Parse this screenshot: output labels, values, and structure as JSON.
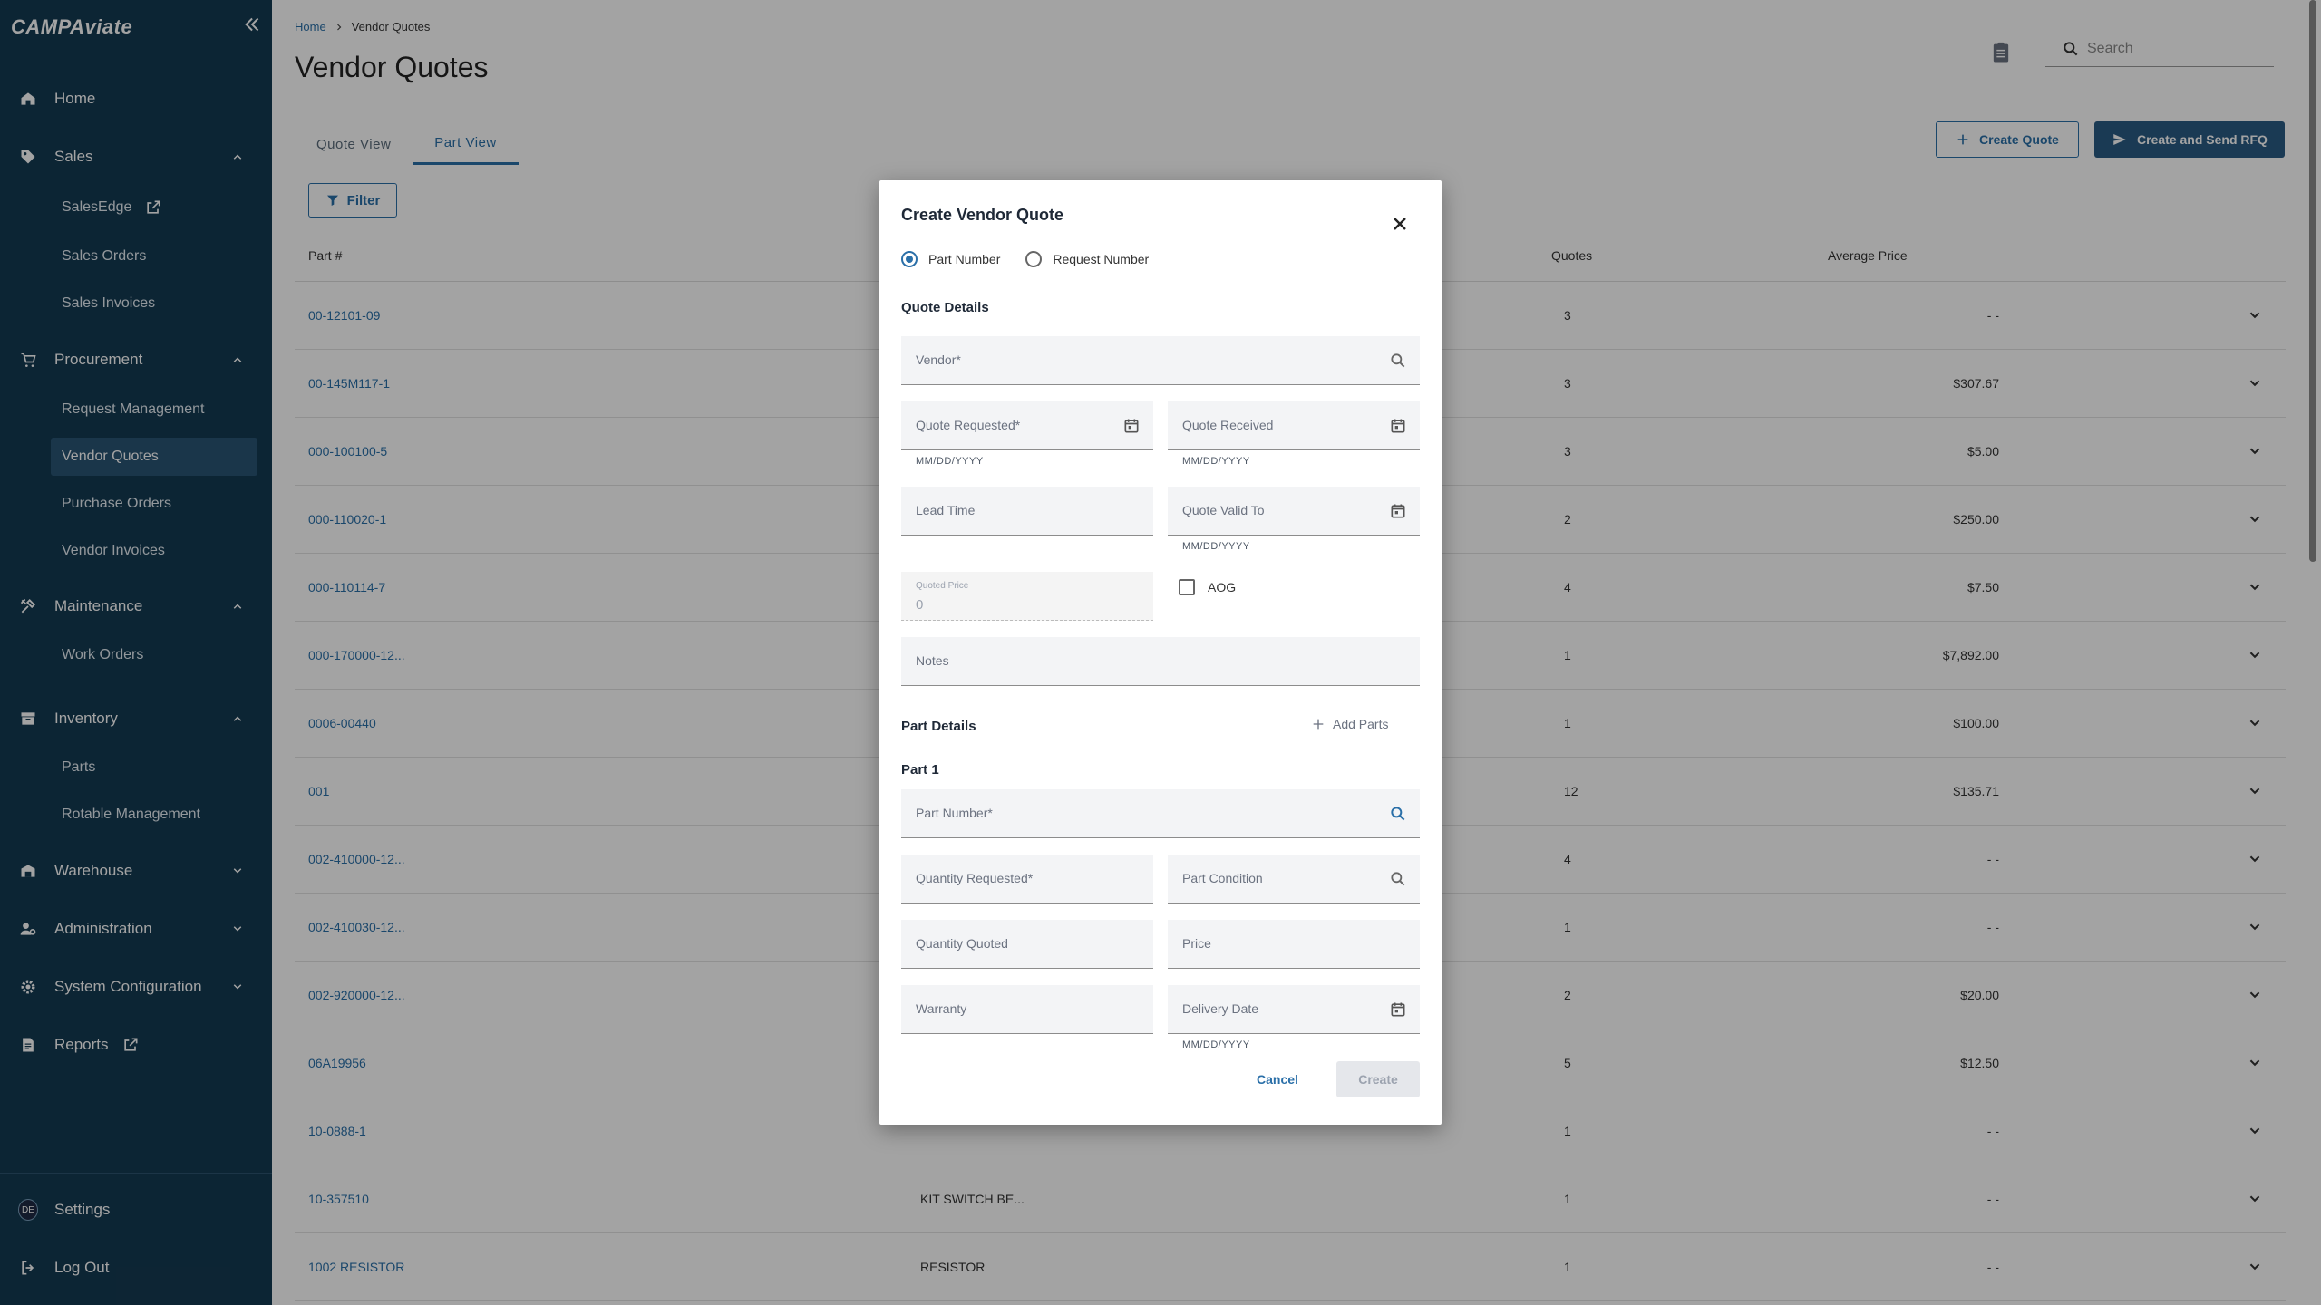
{
  "app": {
    "logo": "CAMPAviate"
  },
  "sidebar": {
    "items": [
      {
        "label": "Home",
        "icon": "home-icon"
      },
      {
        "label": "Sales",
        "icon": "tag-icon"
      },
      {
        "label": "SalesEdge"
      },
      {
        "label": "Sales Orders"
      },
      {
        "label": "Sales Invoices"
      },
      {
        "label": "Procurement",
        "icon": "cart-icon"
      },
      {
        "label": "Request Management"
      },
      {
        "label": "Vendor Quotes"
      },
      {
        "label": "Purchase Orders"
      },
      {
        "label": "Vendor Invoices"
      },
      {
        "label": "Maintenance",
        "icon": "tools-icon"
      },
      {
        "label": "Work Orders"
      },
      {
        "label": "Inventory",
        "icon": "inventory-icon"
      },
      {
        "label": "Parts"
      },
      {
        "label": "Rotable Management"
      },
      {
        "label": "Warehouse",
        "icon": "warehouse-icon"
      },
      {
        "label": "Administration",
        "icon": "admin-icon"
      },
      {
        "label": "System Configuration",
        "icon": "gear-icon"
      },
      {
        "label": "Reports",
        "icon": "report-icon"
      }
    ],
    "settings": "Settings",
    "avatar_initials": "DE",
    "logout": "Log Out"
  },
  "breadcrumb": {
    "home": "Home",
    "current": "Vendor Quotes"
  },
  "page": {
    "title": "Vendor Quotes"
  },
  "search": {
    "placeholder": "Search"
  },
  "tabs": [
    {
      "label": "Quote View"
    },
    {
      "label": "Part View"
    }
  ],
  "actions": {
    "create_quote": "Create Quote",
    "create_send_rfq": "Create and Send RFQ",
    "filter": "Filter"
  },
  "table": {
    "headers": {
      "part": "Part #",
      "quotes": "Quotes",
      "avg_price": "Average Price"
    },
    "rows": [
      {
        "part": "00-12101-09",
        "desc": "",
        "quotes": "3",
        "price": "- -"
      },
      {
        "part": "00-145M117-1",
        "desc": "",
        "quotes": "3",
        "price": "$307.67"
      },
      {
        "part": "000-100100-5",
        "desc": "",
        "quotes": "3",
        "price": "$5.00"
      },
      {
        "part": "000-110020-1",
        "desc": "",
        "quotes": "2",
        "price": "$250.00"
      },
      {
        "part": "000-110114-7",
        "desc": "",
        "quotes": "4",
        "price": "$7.50"
      },
      {
        "part": "000-170000-12...",
        "desc": "",
        "quotes": "1",
        "price": "$7,892.00"
      },
      {
        "part": "0006-00440",
        "desc": "",
        "quotes": "1",
        "price": "$100.00"
      },
      {
        "part": "001",
        "desc": "",
        "quotes": "12",
        "price": "$135.71"
      },
      {
        "part": "002-410000-12...",
        "desc": "",
        "quotes": "4",
        "price": "- -"
      },
      {
        "part": "002-410030-12...",
        "desc": "",
        "quotes": "1",
        "price": "- -"
      },
      {
        "part": "002-920000-12...",
        "desc": "",
        "quotes": "2",
        "price": "$20.00"
      },
      {
        "part": "06A19956",
        "desc": "",
        "quotes": "5",
        "price": "$12.50"
      },
      {
        "part": "10-0888-1",
        "desc": "",
        "quotes": "1",
        "price": "- -"
      },
      {
        "part": "10-357510",
        "desc": "KIT SWITCH BE...",
        "quotes": "1",
        "price": "- -"
      },
      {
        "part": "1002 RESISTOR",
        "desc": "RESISTOR",
        "quotes": "1",
        "price": "- -"
      }
    ]
  },
  "modal": {
    "title": "Create Vendor Quote",
    "radio": {
      "part_number": "Part Number",
      "request_number": "Request Number"
    },
    "quote_details": "Quote Details",
    "vendor": "Vendor*",
    "quote_requested": "Quote Requested*",
    "quote_received": "Quote Received",
    "date_format": "MM/DD/YYYY",
    "lead_time": "Lead Time",
    "quote_valid_to": "Quote Valid To",
    "quoted_price_label": "Quoted Price",
    "quoted_price_value": "0",
    "aog": "AOG",
    "notes": "Notes",
    "part_details": "Part Details",
    "add_parts": "Add Parts",
    "part1": "Part 1",
    "part_number": "Part Number*",
    "quantity_requested": "Quantity Requested*",
    "part_condition": "Part Condition",
    "quantity_quoted": "Quantity Quoted",
    "price": "Price",
    "warranty": "Warranty",
    "delivery_date": "Delivery Date",
    "cancel": "Cancel",
    "create": "Create"
  },
  "colors": {
    "sidebar_bg": "#143a52",
    "accent": "#2a6fa8",
    "primary_button": "#2a5b84"
  }
}
